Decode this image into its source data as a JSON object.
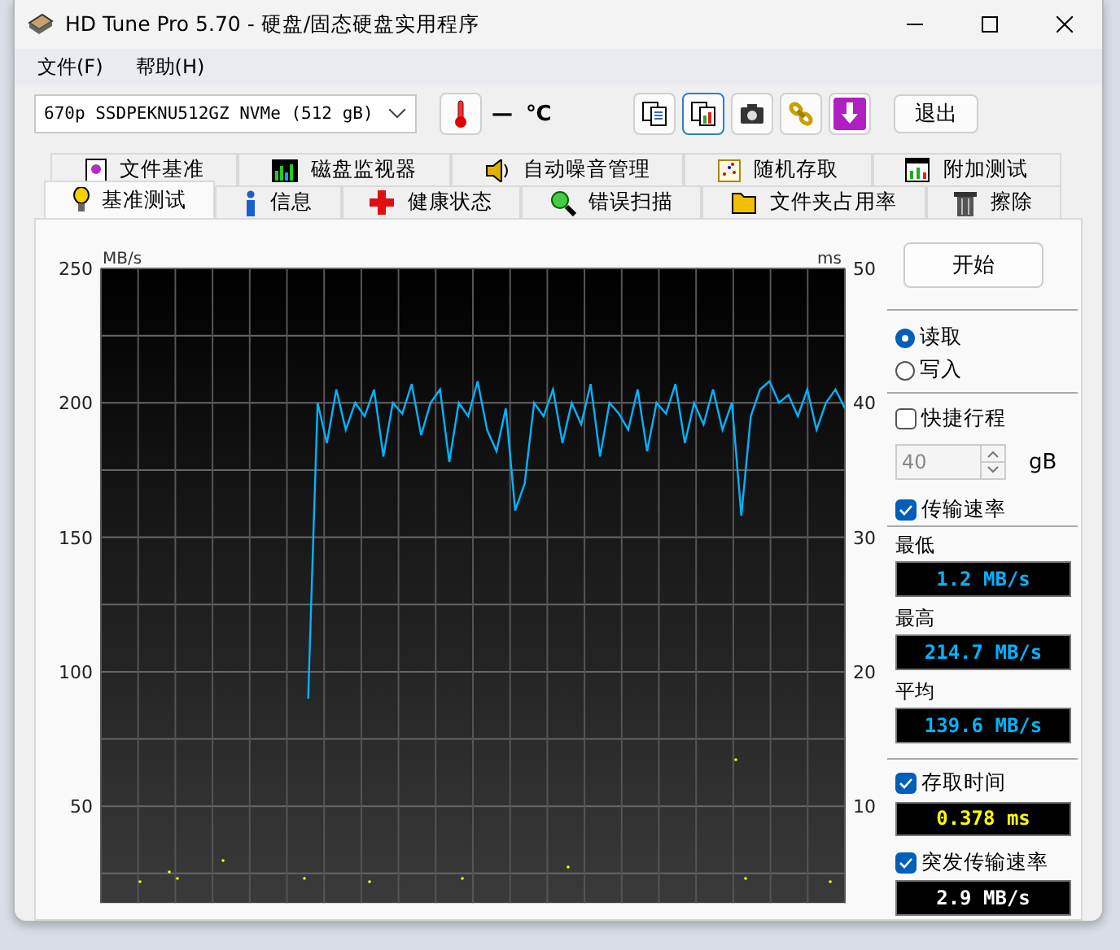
{
  "window": {
    "title": "HD Tune Pro 5.70 - 硬盘/固态硬盘实用程序"
  },
  "menu": [
    "文件(F)",
    "帮助(H)"
  ],
  "toolbar": {
    "drive": "670p SSDPEKNU512GZ NVMe (512 gB)",
    "temperature": "—",
    "temperature_unit": "℃",
    "buttons": [
      {
        "selected": false
      },
      {
        "selected": true
      },
      {
        "selected": false
      },
      {
        "selected": false
      },
      {
        "selected": false
      }
    ],
    "exit": "退出"
  },
  "tabs_top": [
    {
      "label": "文件基准",
      "selected": false
    },
    {
      "label": "磁盘监视器",
      "selected": false
    },
    {
      "label": "自动噪音管理",
      "selected": false
    },
    {
      "label": "随机存取",
      "selected": false
    },
    {
      "label": "附加测试",
      "selected": false
    }
  ],
  "tabs_bottom": [
    {
      "label": "基准测试",
      "selected": true
    },
    {
      "label": "信息",
      "selected": false
    },
    {
      "label": "健康状态",
      "selected": false
    },
    {
      "label": "错误扫描",
      "selected": false
    },
    {
      "label": "文件夹占用率",
      "selected": false
    },
    {
      "label": "擦除",
      "selected": false
    }
  ],
  "chart_data": {
    "type": "line",
    "ylabel": "MB/s",
    "ylim": [
      14,
      250
    ],
    "yticks": [
      50,
      100,
      150,
      200,
      250
    ],
    "grid": true,
    "categories": [
      null,
      null,
      null,
      null,
      null,
      null,
      null,
      null,
      null,
      null,
      null,
      null,
      null,
      null,
      null,
      null,
      null,
      null,
      null,
      null,
      null,
      null,
      null,
      null,
      null,
      null,
      null,
      null,
      null,
      null,
      null,
      null,
      null,
      null,
      null,
      null,
      null,
      null,
      null,
      null,
      null,
      null,
      null,
      null,
      null,
      null,
      null,
      null,
      null,
      null,
      null,
      null,
      null,
      null,
      null,
      null,
      null,
      null
    ],
    "series": [
      {
        "color": "#00b4ff",
        "values": [
          90,
          200,
          185,
          205,
          190,
          200,
          195,
          205,
          180,
          200,
          196,
          207,
          188,
          200,
          205,
          178,
          200,
          195,
          208,
          190,
          182,
          198,
          160,
          170,
          200,
          195,
          205,
          185,
          200,
          192,
          207,
          180,
          200,
          196,
          190,
          205,
          182,
          200,
          196,
          207,
          185,
          200,
          192,
          205,
          190,
          200,
          158,
          195,
          205,
          208,
          200,
          203,
          195,
          205,
          190,
          200,
          205,
          198
        ]
      }
    ]
  },
  "right_axis": {
    "label": "ms",
    "ticks": [
      "50",
      "40",
      "30",
      "20",
      "10"
    ]
  },
  "panel": {
    "start": "开始",
    "modes": [
      {
        "label": "读取",
        "selected": true
      },
      {
        "label": "写入",
        "selected": false
      }
    ],
    "short_stroke": {
      "label": "快捷行程",
      "checked": false,
      "value": "40",
      "disabled": true,
      "unit": "gB"
    },
    "transfer_rate": {
      "label": "传输速率",
      "checked": true
    },
    "readouts": [
      {
        "label": "最低",
        "value": "1.2 MB/s",
        "color": "#00b4ff"
      },
      {
        "label": "最高",
        "value": "214.7 MB/s",
        "color": "#00b4ff"
      },
      {
        "label": "平均",
        "value": "139.6 MB/s",
        "color": "#00b4ff"
      }
    ],
    "access_time": {
      "label": "存取时间",
      "checked": true,
      "value": "0.378 ms",
      "color": "#ffff00"
    },
    "burst_rate": {
      "label": "突发传输速率",
      "checked": true,
      "value": "2.9 MB/s",
      "color": "#ffffff"
    }
  }
}
